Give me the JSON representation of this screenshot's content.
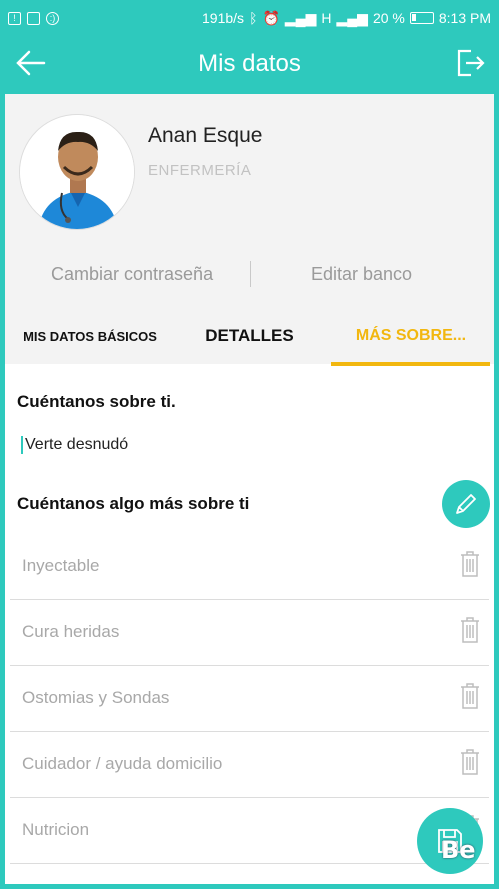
{
  "status_bar": {
    "net_speed": "191b/s",
    "signal_label": "H",
    "battery": "20 %",
    "time": "8:13 PM"
  },
  "app_bar": {
    "title": "Mis datos",
    "back_icon": "arrow-left-icon",
    "logout_icon": "logout-icon"
  },
  "profile": {
    "name": "Anan Esque",
    "role": "ENFERMERÍA",
    "change_password": "Cambiar contraseña",
    "edit_bank": "Editar banco"
  },
  "tabs": [
    {
      "label": "MIS DATOS BÁSICOS",
      "active": false
    },
    {
      "label": "DETALLES",
      "active": false
    },
    {
      "label": "MÁS SOBRE...",
      "active": true
    }
  ],
  "about": {
    "title": "Cuéntanos sobre ti.",
    "value": "Verte desnudó"
  },
  "more_about": {
    "title": "Cuéntanos algo más sobre ti",
    "items": [
      "Inyectable",
      "Cura heridas",
      "Ostomias y Sondas",
      "Cuidador / ayuda domicilio",
      "Nutricion"
    ]
  },
  "watermark": "Be",
  "colors": {
    "primary": "#2ec9bd",
    "accent": "#f2b70f"
  }
}
